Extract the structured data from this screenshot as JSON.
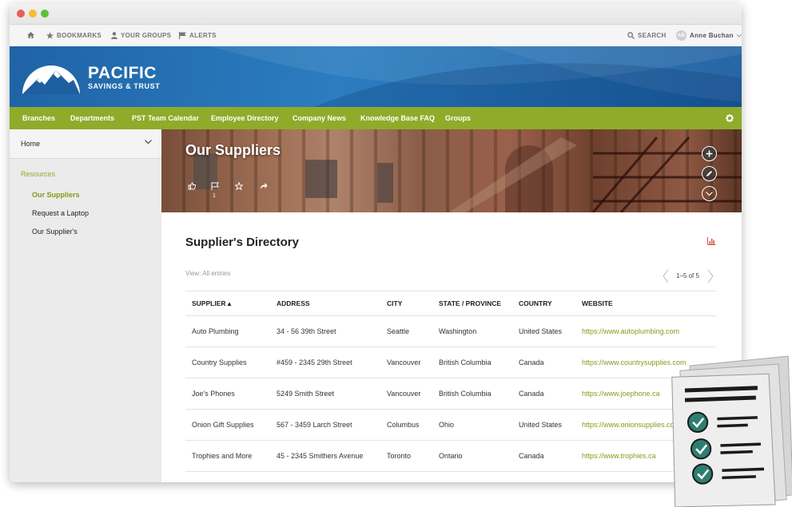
{
  "topbar": {
    "bookmarks": "BOOKMARKS",
    "your_groups": "YOUR GROUPS",
    "alerts": "ALERTS",
    "search": "SEARCH",
    "user_initials": "AB",
    "user_name": "Anne Buchan"
  },
  "brand": {
    "name": "PACIFIC",
    "tagline": "SAVINGS & TRUST"
  },
  "nav": [
    "Branches",
    "Departments",
    "PST Team Calendar",
    "Employee Directory",
    "Company News",
    "Knowledge Base FAQ",
    "Groups"
  ],
  "sidebar": {
    "home": "Home",
    "section": "Resources",
    "items": [
      "Our Suppliers",
      "Request a Laptop",
      "Our Supplier's"
    ]
  },
  "hero": {
    "title": "Our Suppliers",
    "flag_count": "1"
  },
  "directory": {
    "title": "Supplier's Directory",
    "view": "View: All entries",
    "pager": "1–5 of 5",
    "headers": [
      "SUPPLIER ▴",
      "ADDRESS",
      "CITY",
      "STATE / PROVINCE",
      "COUNTRY",
      "WEBSITE"
    ],
    "rows": [
      [
        "Auto Plumbing",
        "34 - 56 39th Street",
        "Seattle",
        "Washington",
        "United States",
        "https://www.autoplumbing.com"
      ],
      [
        "Country Supplies",
        "#459 - 2345 29th Street",
        "Vancouver",
        "British Columbia",
        "Canada",
        "https://www.countrysupplies.com"
      ],
      [
        "Joe's Phones",
        "5249 Smith Street",
        "Vancouver",
        "British Columbia",
        "Canada",
        "https://www.joephone.ca"
      ],
      [
        "Onion Gift Supplies",
        "567 - 3459 Larch Street",
        "Columbus",
        "Ohio",
        "United States",
        "https://www.onionsupplies.com"
      ],
      [
        "Trophies and More",
        "45 - 2345 Smithers Avenue",
        "Toronto",
        "Ontario",
        "Canada",
        "https://www.trophies.ca"
      ]
    ]
  },
  "colors": {
    "accent_green": "#8fab2a",
    "banner_blue": "#2b7dc0",
    "link_green": "#7f9e19",
    "chart_icon": "#d9534f"
  },
  "icons": {
    "home": "home-icon",
    "bookmarks": "star-icon",
    "groups": "user-icon",
    "alerts": "flag-icon",
    "search": "search-icon",
    "settings": "gear-icon"
  }
}
